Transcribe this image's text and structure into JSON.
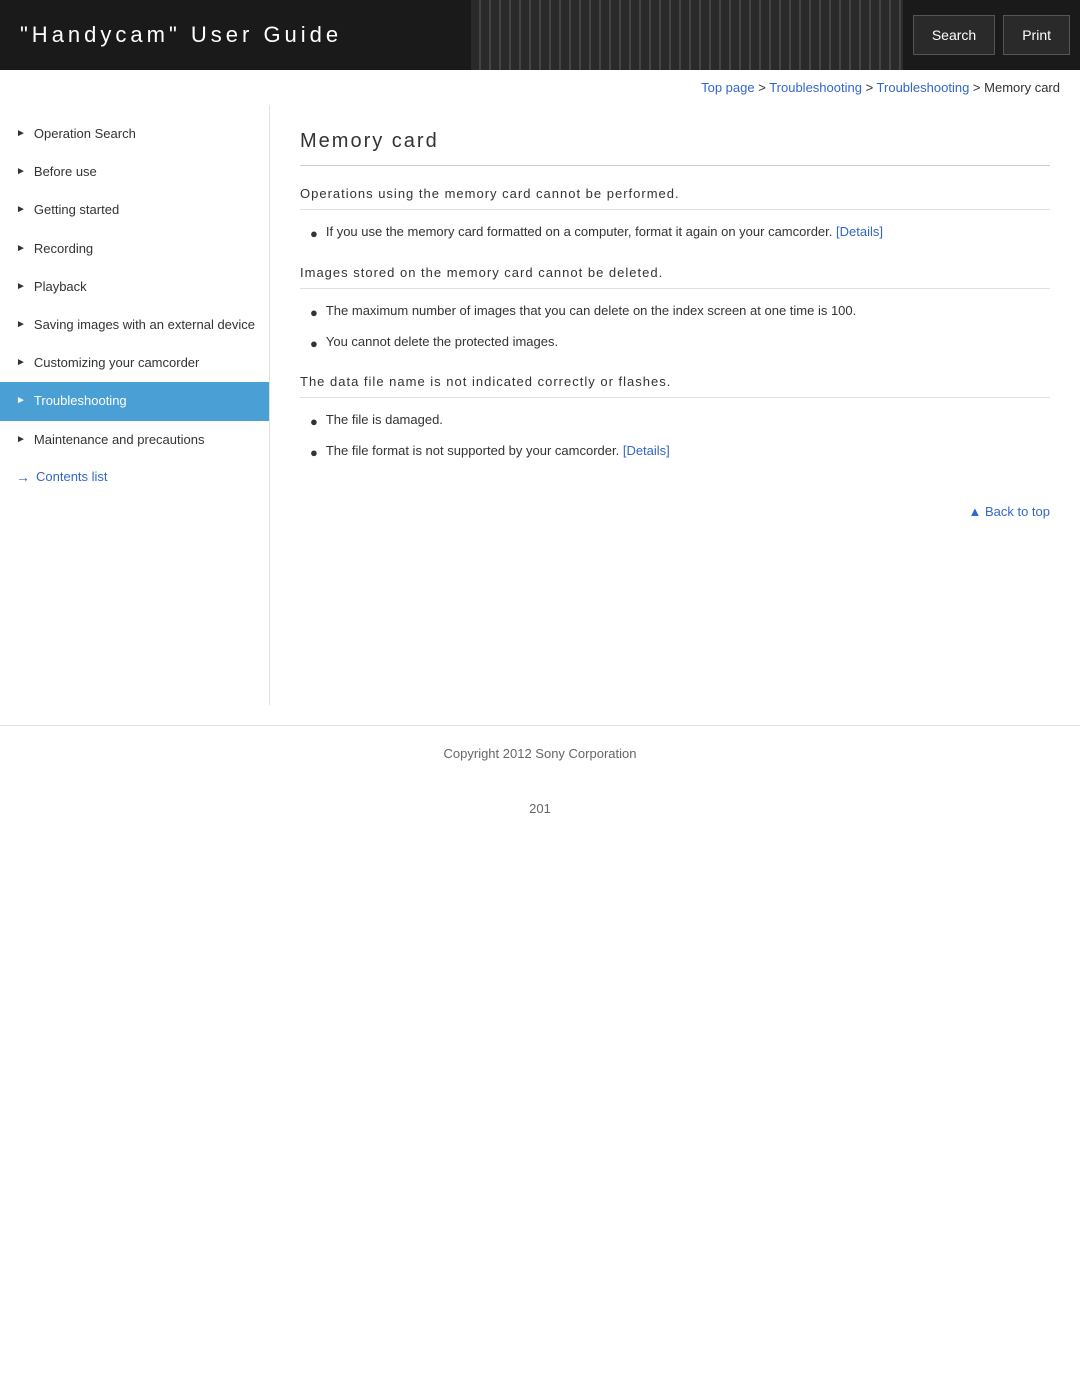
{
  "header": {
    "title": "\"Handycam\" User Guide",
    "search_label": "Search",
    "print_label": "Print"
  },
  "breadcrumb": {
    "items": [
      {
        "label": "Top page",
        "link": true
      },
      {
        "label": "Troubleshooting",
        "link": true
      },
      {
        "label": "Troubleshooting",
        "link": true
      },
      {
        "label": "Memory card",
        "link": false
      }
    ],
    "separator": " > "
  },
  "sidebar": {
    "items": [
      {
        "id": "operation-search",
        "label": "Operation Search",
        "active": false
      },
      {
        "id": "before-use",
        "label": "Before use",
        "active": false
      },
      {
        "id": "getting-started",
        "label": "Getting started",
        "active": false
      },
      {
        "id": "recording",
        "label": "Recording",
        "active": false
      },
      {
        "id": "playback",
        "label": "Playback",
        "active": false
      },
      {
        "id": "saving-images",
        "label": "Saving images with an external device",
        "active": false
      },
      {
        "id": "customizing",
        "label": "Customizing your camcorder",
        "active": false
      },
      {
        "id": "troubleshooting",
        "label": "Troubleshooting",
        "active": true
      },
      {
        "id": "maintenance",
        "label": "Maintenance and precautions",
        "active": false
      }
    ],
    "contents_list_label": "Contents list"
  },
  "main": {
    "page_title": "Memory card",
    "sections": [
      {
        "id": "section1",
        "heading": "Operations using the memory card cannot be performed.",
        "bullets": [
          {
            "text": "If you use the memory card formatted on a computer, format it again on your camcorder.",
            "link_label": "[Details]",
            "has_link": true
          }
        ]
      },
      {
        "id": "section2",
        "heading": "Images stored on the memory card cannot be deleted.",
        "bullets": [
          {
            "text": "The maximum number of images that you can delete on the index screen at one time is 100.",
            "has_link": false
          },
          {
            "text": "You cannot delete the protected images.",
            "has_link": false
          }
        ]
      },
      {
        "id": "section3",
        "heading": "The data file name is not indicated correctly or flashes.",
        "bullets": [
          {
            "text": "The file is damaged.",
            "has_link": false
          },
          {
            "text": "The file format is not supported by your camcorder.",
            "link_label": "[Details]",
            "has_link": true
          }
        ]
      }
    ],
    "back_to_top_label": "▲ Back to top"
  },
  "footer": {
    "copyright": "Copyright 2012 Sony Corporation"
  },
  "page_number": "201"
}
